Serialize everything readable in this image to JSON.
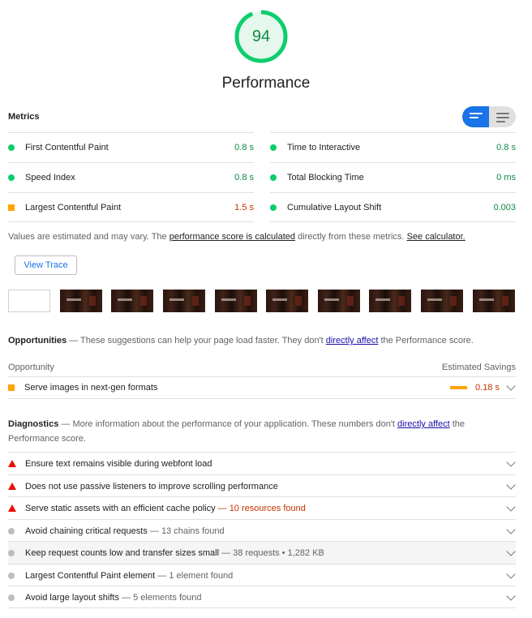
{
  "gauge": {
    "score": "94",
    "title": "Performance",
    "fraction": 0.94,
    "color": "#0cce6b"
  },
  "metrics": {
    "title": "Metrics",
    "left": [
      {
        "label": "First Contentful Paint",
        "value": "0.8 s",
        "status": "pass"
      },
      {
        "label": "Speed Index",
        "value": "0.8 s",
        "status": "pass"
      },
      {
        "label": "Largest Contentful Paint",
        "value": "1.5 s",
        "status": "average"
      }
    ],
    "right": [
      {
        "label": "Time to Interactive",
        "value": "0.8 s",
        "status": "pass"
      },
      {
        "label": "Total Blocking Time",
        "value": "0 ms",
        "status": "pass"
      },
      {
        "label": "Cumulative Layout Shift",
        "value": "0.003",
        "status": "pass"
      }
    ],
    "note_prefix": "Values are estimated and may vary. The ",
    "note_link1": "performance score is calculated",
    "note_middle": " directly from these metrics. ",
    "note_link2": "See calculator."
  },
  "view_trace_label": "View Trace",
  "filmstrip": {
    "frame_count": 10
  },
  "opportunities": {
    "title": "Opportunities",
    "desc_prefix": " — These suggestions can help your page load faster. They don't ",
    "desc_link": "directly affect",
    "desc_suffix": " the Performance score.",
    "col_opportunity": "Opportunity",
    "col_savings": "Estimated Savings",
    "items": [
      {
        "label": "Serve images in next-gen formats",
        "savings": "0.18 s",
        "status": "average"
      }
    ]
  },
  "diagnostics": {
    "title": "Diagnostics",
    "desc_prefix": " — More information about the performance of your application. These numbers don't ",
    "desc_link": "directly affect",
    "desc_suffix": " the Performance score.",
    "items": [
      {
        "label": "Ensure text remains visible during webfont load",
        "detail": "",
        "status": "fail"
      },
      {
        "label": "Does not use passive listeners to improve scrolling performance",
        "detail": "",
        "status": "fail"
      },
      {
        "label": "Serve static assets with an efficient cache policy",
        "detail": " — 10 resources found",
        "status": "fail"
      },
      {
        "label": "Avoid chaining critical requests",
        "detail": " — 13 chains found",
        "status": "info"
      },
      {
        "label": "Keep request counts low and transfer sizes small",
        "detail": " — 38 requests • 1,282 KB",
        "status": "info"
      },
      {
        "label": "Largest Contentful Paint element",
        "detail": " — 1 element found",
        "status": "info"
      },
      {
        "label": "Avoid large layout shifts",
        "detail": " — 5 elements found",
        "status": "info"
      }
    ]
  }
}
